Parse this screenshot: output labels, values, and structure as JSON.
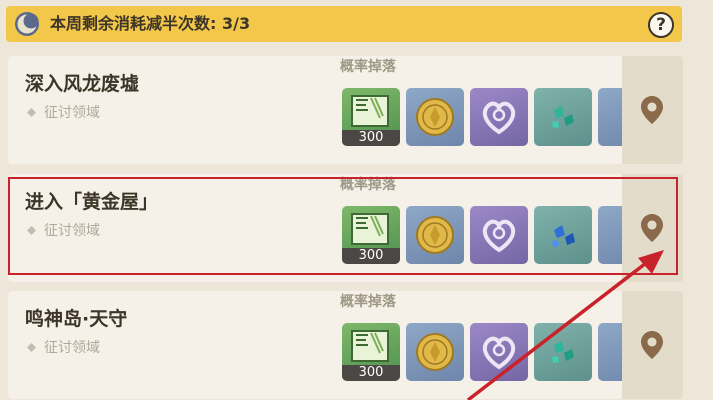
{
  "banner": {
    "text": "本周剩余消耗减半次数: 3/3",
    "help_label": "?"
  },
  "cards": [
    {
      "name": "深入风龙废墟",
      "subtitle": "征讨领域",
      "drops_label": "概率掉落",
      "items": [
        {
          "icon": "experience-book-icon",
          "count": "300"
        },
        {
          "icon": "mora-coin-icon"
        },
        {
          "icon": "purple-heart-emblem-icon"
        },
        {
          "icon": "teal-crystal-icon"
        }
      ]
    },
    {
      "name": "进入「黄金屋」",
      "subtitle": "征讨领域",
      "drops_label": "概率掉落",
      "items": [
        {
          "icon": "experience-book-icon",
          "count": "300"
        },
        {
          "icon": "mora-coin-icon"
        },
        {
          "icon": "purple-heart-emblem-icon"
        },
        {
          "icon": "blue-crystal-icon"
        }
      ]
    },
    {
      "name": "鸣神岛·天守",
      "subtitle": "征讨领域",
      "drops_label": "概率掉落",
      "items": [
        {
          "icon": "experience-book-icon",
          "count": "300"
        },
        {
          "icon": "mora-coin-icon"
        },
        {
          "icon": "purple-heart-emblem-icon"
        },
        {
          "icon": "teal-crystal-icon"
        }
      ]
    }
  ],
  "colors": {
    "banner": "#f3c84a",
    "card": "#f5f1e9",
    "highlight_box": "#c8232b",
    "arrow": "#c8232b",
    "pin": "#8a6a4a"
  }
}
